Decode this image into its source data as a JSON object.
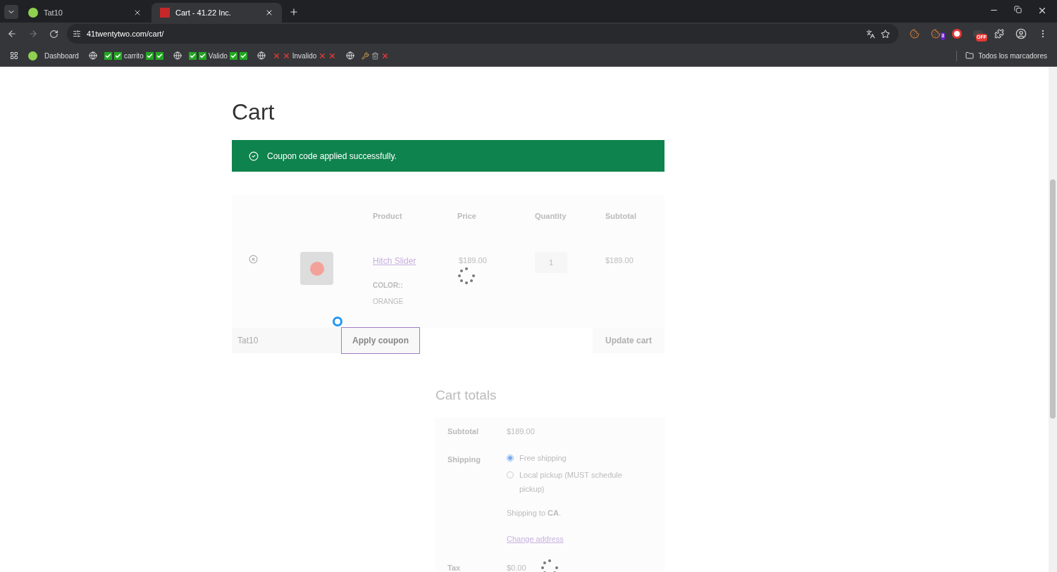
{
  "tabs": [
    {
      "title": "Tat10",
      "selected": false
    },
    {
      "title": "Cart - 41.22 Inc.",
      "selected": true
    }
  ],
  "address": "41twentytwo.com/cart/",
  "extensions": [
    {
      "kind": "cookie"
    },
    {
      "kind": "cookie",
      "badge": "3"
    },
    {
      "kind": "blocker"
    },
    {
      "kind": "off",
      "badge": "OFF"
    },
    {
      "kind": "puzzle"
    }
  ],
  "bookmarks": [
    {
      "label": "Dashboard",
      "kind": "app"
    },
    {
      "label": "carrito",
      "kind": "valid"
    },
    {
      "label": "Valido",
      "kind": "valid"
    },
    {
      "label": "Invalido",
      "kind": "invalid"
    },
    {
      "kind": "tools"
    }
  ],
  "all_bookmarks": "Todos los marcadores",
  "page": {
    "title": "Cart",
    "notice": "Coupon code applied successfully.",
    "columns": [
      "Product",
      "Price",
      "Quantity",
      "Subtotal"
    ],
    "items": [
      {
        "name": "Hitch Slider",
        "attribute": "COLOR::",
        "attribute_value": "ORANGE",
        "price": "$189.00",
        "quantity": "1",
        "subtotal": "$189.00"
      }
    ],
    "coupon": {
      "value": "Tat10",
      "apply": "Apply coupon",
      "update": "Update cart"
    },
    "totals": {
      "title": "Cart totals",
      "subtotal_label": "Subtotal",
      "subtotal": "$189.00",
      "shipping_label": "Shipping",
      "shipping_options": [
        {
          "label": "Free shipping",
          "selected": true
        },
        {
          "label": "Local pickup (MUST schedule pickup)",
          "selected": false
        }
      ],
      "shipping_to": "Shipping to **CA**.",
      "change_address": "Change address",
      "tax_label": "Tax",
      "tax": "$0.00"
    }
  }
}
